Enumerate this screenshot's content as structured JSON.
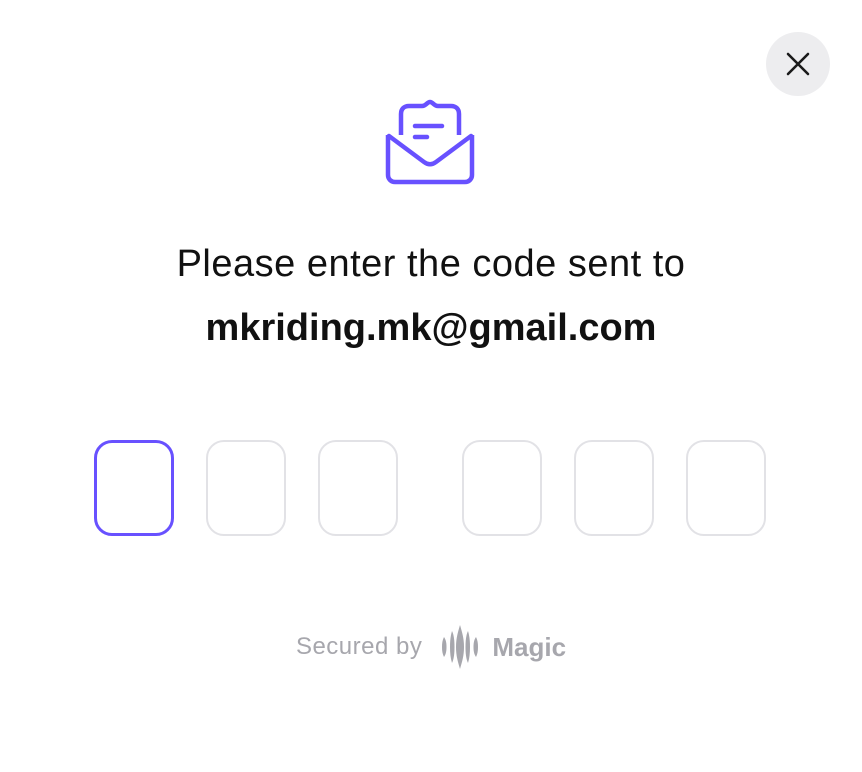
{
  "dialog": {
    "close_label": "Close",
    "mail_icon": "open-envelope-icon",
    "prompt": "Please enter the code sent to",
    "email": "mkriding.mk@gmail.com"
  },
  "code_inputs": [
    {
      "value": "",
      "active": true
    },
    {
      "value": "",
      "active": false
    },
    {
      "value": "",
      "active": false
    },
    {
      "value": "",
      "active": false
    },
    {
      "value": "",
      "active": false
    },
    {
      "value": "",
      "active": false
    }
  ],
  "footer": {
    "secured_by": "Secured by",
    "brand": "Magic",
    "brand_icon": "magic-logo-icon"
  },
  "colors": {
    "accent": "#6851ff",
    "text": "#111111",
    "muted": "#a7a7ad",
    "box_border": "#e2e2e6",
    "close_bg": "#ededef"
  }
}
